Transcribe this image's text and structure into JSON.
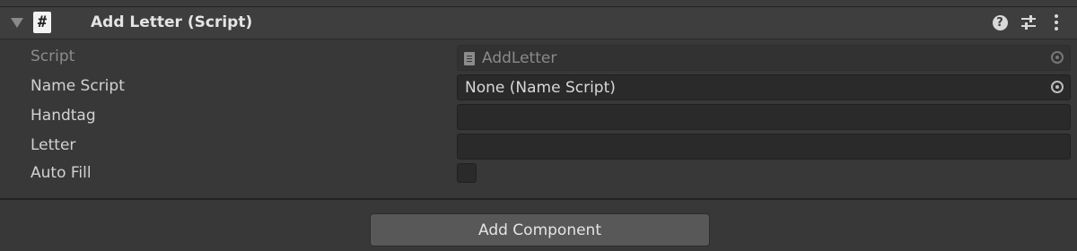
{
  "component": {
    "title": "Add Letter (Script)",
    "header_icons": [
      "help-icon",
      "preset-sliders-icon",
      "kebab-menu-icon"
    ],
    "fields": {
      "script": {
        "label": "Script",
        "value": "AddLetter"
      },
      "name_script": {
        "label": "Name Script",
        "value": "None (Name Script)"
      },
      "handtag": {
        "label": "Handtag",
        "value": ""
      },
      "letter": {
        "label": "Letter",
        "value": ""
      },
      "auto_fill": {
        "label": "Auto Fill",
        "checked": false
      }
    }
  },
  "add_component_label": "Add Component",
  "colors": {
    "background": "#383838",
    "header": "#3e3e3e",
    "field": "#2a2a2a",
    "button": "#585858",
    "text": "#d2d2d2"
  }
}
